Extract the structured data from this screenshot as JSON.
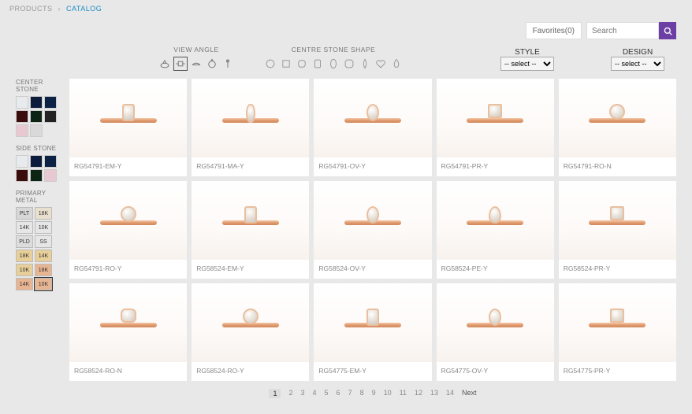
{
  "breadcrumb": {
    "root": "PRODUCTS",
    "current": "CATALOG"
  },
  "topbar": {
    "favorites_label": "Favorites(0)",
    "search_placeholder": "Search"
  },
  "controls": {
    "view_angle_label": "VIEW ANGLE",
    "centre_stone_shape_label": "CENTRE STONE SHAPE",
    "style_label": "STYLE",
    "style_placeholder": "-- select --",
    "design_label": "DESIGN",
    "design_placeholder": "-- select --",
    "view_angles": [
      "angle-perspective",
      "angle-top",
      "angle-side",
      "angle-through",
      "angle-profile"
    ],
    "view_angle_selected": "angle-top",
    "stone_shapes": [
      "round",
      "princess",
      "cushion",
      "emerald",
      "oval",
      "radiant",
      "marquise",
      "heart",
      "pear"
    ]
  },
  "sidebar": {
    "center_stone_label": "CENTER STONE",
    "center_stone_colors": [
      "#e8ebee",
      "#0b1b3b",
      "#0b2244",
      "#3a0c0c",
      "#0d2414",
      "#222222",
      "#e9c9d1",
      "#d9d9d9"
    ],
    "side_stone_label": "SIDE STONE",
    "side_stone_colors": [
      "#e8ebee",
      "#0b1b3b",
      "#0b2244",
      "#3a0c0c",
      "#0d2414",
      "#e9c9d1"
    ],
    "primary_metal_label": "PRIMARY METAL",
    "metals": [
      {
        "label": "PLT",
        "bg": "#d7d7d7"
      },
      {
        "label": "18K",
        "bg": "#e8e0cc"
      },
      {
        "label": "14K",
        "bg": "#e6e6e6"
      },
      {
        "label": "10K",
        "bg": "#e6e6e6"
      },
      {
        "label": "PLD",
        "bg": "#dcdcdc"
      },
      {
        "label": "SS",
        "bg": "#e6e6e6"
      },
      {
        "label": "18K",
        "bg": "#e8cf99"
      },
      {
        "label": "14K",
        "bg": "#e8cf99"
      },
      {
        "label": "10K",
        "bg": "#e8cf99"
      },
      {
        "label": "18K",
        "bg": "#e8b592"
      },
      {
        "label": "14K",
        "bg": "#e8b592"
      },
      {
        "label": "10K",
        "bg": "#e8b592",
        "selected": true
      }
    ]
  },
  "products": [
    {
      "sku": "RG54791-EM-Y",
      "shape": "em"
    },
    {
      "sku": "RG54791-MA-Y",
      "shape": "mq"
    },
    {
      "sku": "RG54791-OV-Y",
      "shape": "ov"
    },
    {
      "sku": "RG54791-PR-Y",
      "shape": "pr"
    },
    {
      "sku": "RG54791-RO-N",
      "shape": "rd"
    },
    {
      "sku": "RG54791-RO-Y",
      "shape": "rd"
    },
    {
      "sku": "RG58524-EM-Y",
      "shape": "em"
    },
    {
      "sku": "RG58524-OV-Y",
      "shape": "ov"
    },
    {
      "sku": "RG58524-PE-Y",
      "shape": "pe"
    },
    {
      "sku": "RG58524-PR-Y",
      "shape": "pr"
    },
    {
      "sku": "RG58524-RO-N",
      "shape": "cu"
    },
    {
      "sku": "RG58524-RO-Y",
      "shape": "rd"
    },
    {
      "sku": "RG54775-EM-Y",
      "shape": "em"
    },
    {
      "sku": "RG54775-OV-Y",
      "shape": "ov"
    },
    {
      "sku": "RG54775-PR-Y",
      "shape": "pr"
    }
  ],
  "pager": {
    "pages": [
      "1",
      "2",
      "3",
      "4",
      "5",
      "6",
      "7",
      "8",
      "9",
      "10",
      "11",
      "12",
      "13",
      "14"
    ],
    "current": "1",
    "next_label": "Next"
  }
}
